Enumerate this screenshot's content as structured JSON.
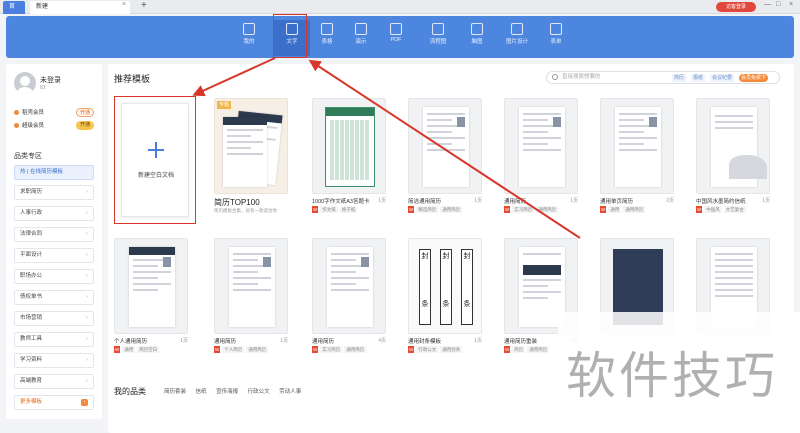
{
  "tabs": [
    {
      "label": "首页"
    },
    {
      "label": "新建"
    }
  ],
  "tabbar": {
    "add": "+",
    "close": "×",
    "login": "访客登录",
    "win": {
      "minimize": "—",
      "maximize": "□",
      "close": "×"
    }
  },
  "ribbon": {
    "items": [
      {
        "label": "我的",
        "icon": "star-icon"
      },
      {
        "label": "文字",
        "icon": "document-icon",
        "active": true
      },
      {
        "label": "表格",
        "icon": "table-icon"
      },
      {
        "label": "演示",
        "icon": "presentation-icon"
      },
      {
        "label": "PDF",
        "icon": "pdf-icon"
      },
      {
        "label": "流程图",
        "icon": "flowchart-icon"
      },
      {
        "label": "脑图",
        "icon": "mindmap-icon"
      },
      {
        "label": "图片设计",
        "icon": "image-design-icon"
      },
      {
        "label": "表单",
        "icon": "form-icon"
      }
    ]
  },
  "user": {
    "name": "未登录",
    "id": "ID:",
    "vip1": {
      "label": "稻壳会员",
      "btn": "开通"
    },
    "vip2": {
      "label": "超级会员",
      "btn": "开通"
    }
  },
  "sidebar": {
    "title": "品类专区",
    "items": [
      {
        "label": "热 | 在线简历模板"
      },
      {
        "label": "求职简历"
      },
      {
        "label": "人事行政"
      },
      {
        "label": "法律合同"
      },
      {
        "label": "平面设计"
      },
      {
        "label": "职场办公"
      },
      {
        "label": "债权单书"
      },
      {
        "label": "市场营销"
      },
      {
        "label": "教师工具"
      },
      {
        "label": "学习资料"
      },
      {
        "label": "高端教育"
      },
      {
        "label": "更多模板"
      }
    ]
  },
  "main": {
    "title": "推荐模板",
    "search": {
      "placeholder": "直接搜索想要的",
      "chips": [
        "简历",
        "报纸",
        "会议纪要",
        "会员免费下"
      ]
    },
    "new_blank": "新建空白文档",
    "top100": {
      "badge": "专题",
      "name": "简历TOP100",
      "sub": "简历模板合集，总有一款适合你"
    },
    "row1": [
      {
        "name": "1000字作文纸A3答题卡",
        "pages": "1页",
        "tags": [
          "作文纸",
          "格子纸"
        ]
      },
      {
        "name": "简洁通用简历",
        "pages": "1页",
        "tags": [
          "精选简历",
          "通用简历"
        ]
      },
      {
        "name": "通用简历",
        "pages": "1页",
        "tags": [
          "实习简历",
          "通用简历"
        ]
      },
      {
        "name": "通用单页简历",
        "pages": "2页",
        "tags": [
          "通用",
          "通用简历"
        ]
      },
      {
        "name": "中国风水墨简约信纸",
        "pages": "1页",
        "tags": [
          "中国风",
          "文艺复古"
        ]
      }
    ],
    "row2": [
      {
        "name": "个人通用简历",
        "pages": "1页",
        "tags": [
          "通用",
          "简历空白"
        ]
      },
      {
        "name": "通用简历",
        "pages": "1页",
        "tags": [
          "个人简历",
          "通用简历"
        ]
      },
      {
        "name": "通用简历",
        "pages": "4页",
        "tags": [
          "实习简历",
          "通用简历"
        ]
      },
      {
        "name": "通用封条模板",
        "pages": "1页",
        "tags": [
          "行政公文",
          "通用封条"
        ]
      },
      {
        "name": "通用简历重装",
        "pages": "1页",
        "tags": [
          "简历",
          "通用简历"
        ]
      },
      {
        "name": "",
        "pages": "",
        "tags": []
      },
      {
        "name": "",
        "pages": "",
        "tags": []
      }
    ],
    "feng_chars": [
      "封",
      "条"
    ],
    "my_categories": {
      "title": "我的品类",
      "links": [
        "简历套装",
        "信纸",
        "宣传海报",
        "行政公文",
        "劳动人事"
      ]
    }
  },
  "watermark": "软件技巧"
}
